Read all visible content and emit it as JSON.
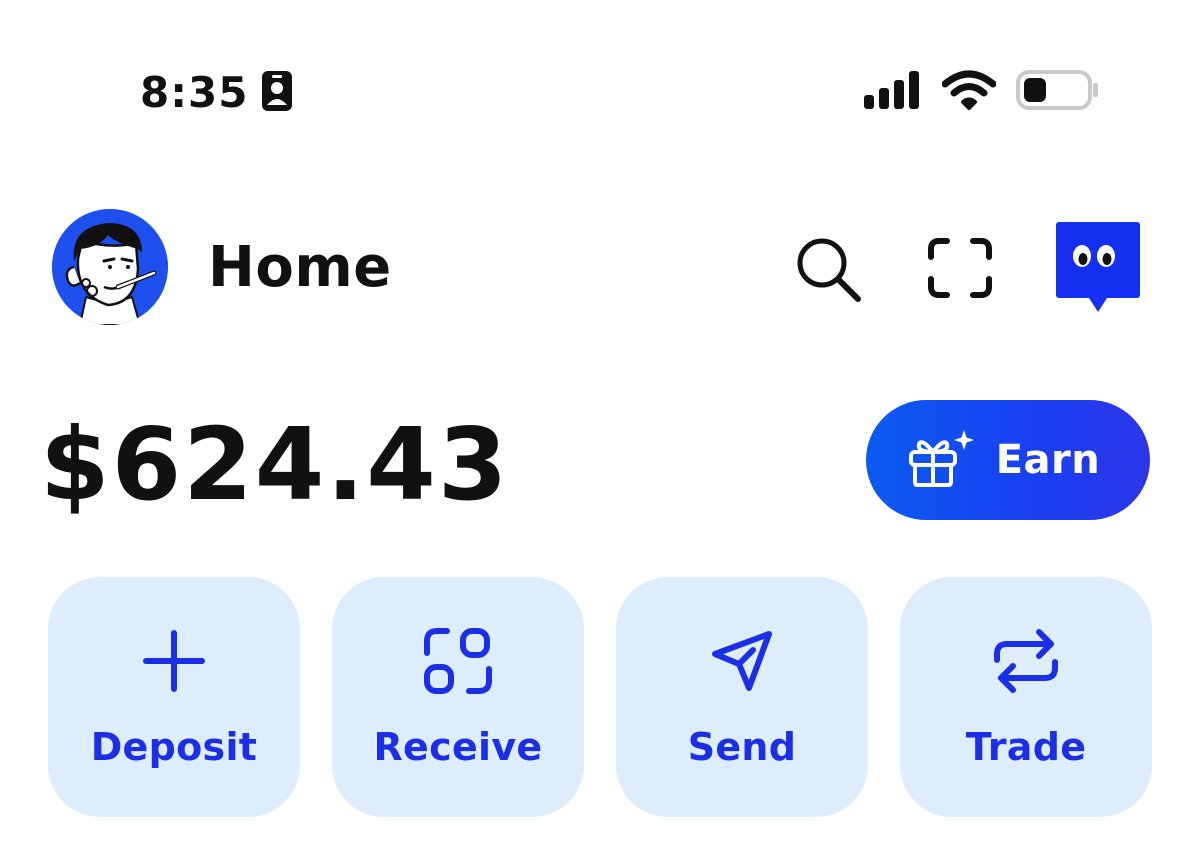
{
  "status_bar": {
    "time": "8:35"
  },
  "header": {
    "title": "Home"
  },
  "balance": {
    "amount": "$624.43"
  },
  "earn_button": {
    "label": "Earn"
  },
  "actions": [
    {
      "label": "Deposit",
      "icon": "plus-icon"
    },
    {
      "label": "Receive",
      "icon": "receive-icon"
    },
    {
      "label": "Send",
      "icon": "send-icon"
    },
    {
      "label": "Trade",
      "icon": "trade-icon"
    }
  ],
  "colors": {
    "accent": "#1b2fe6",
    "tile_background": "#deedfc",
    "chat_icon": "#1530f0",
    "earn_gradient_start": "#0b5bf0",
    "earn_gradient_end": "#2c35e8",
    "text": "#111111",
    "background": "#ffffff"
  }
}
